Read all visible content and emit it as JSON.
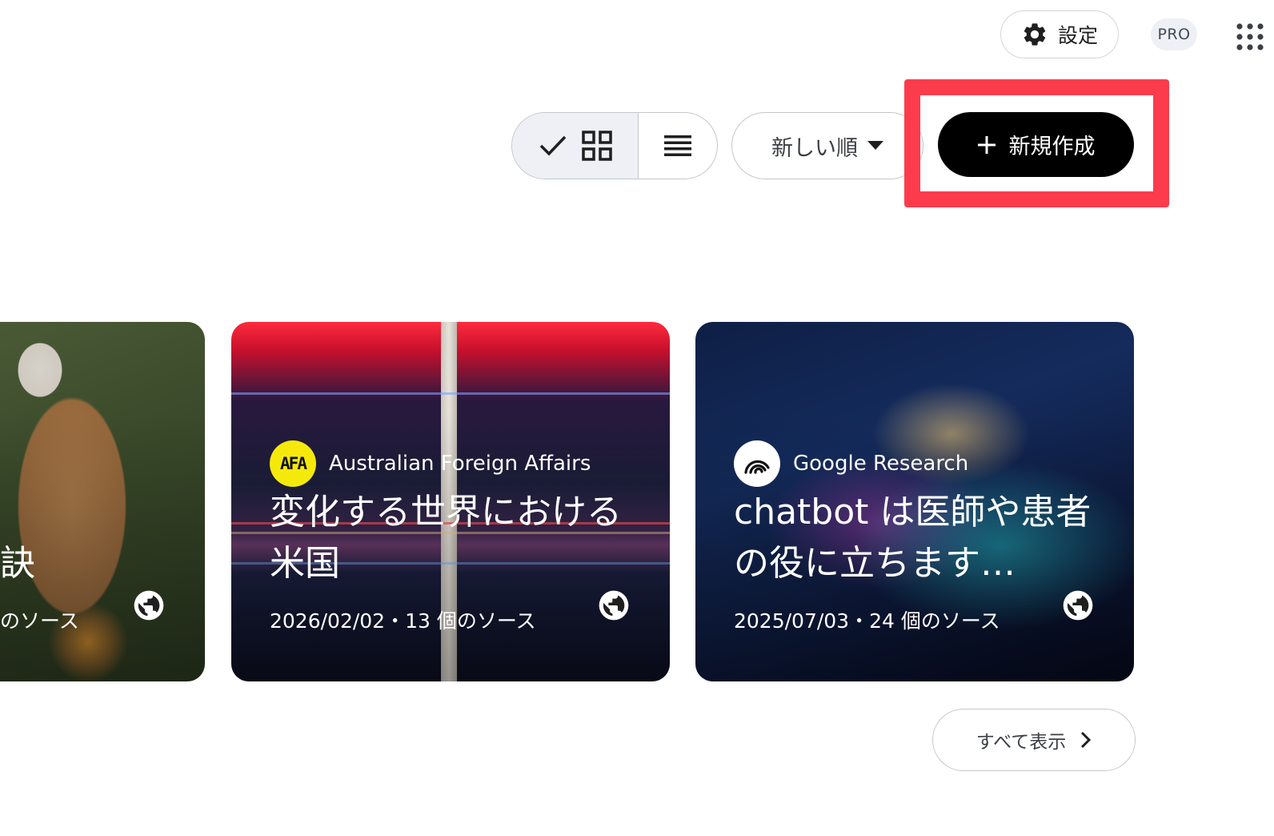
{
  "header": {
    "settings_label": "設定",
    "settings_icon": "gear-icon",
    "plan_badge": "PRO",
    "apps_icon": "apps-grid-icon"
  },
  "toolbar": {
    "view_mode": "grid",
    "grid_view_icon": "grid-icon",
    "list_view_icon": "list-icon",
    "sort_label": "新しい順",
    "new_label": "新規作成",
    "highlight_color": "#fc3b4d"
  },
  "notebooks": [
    {
      "title": "訣",
      "meta": "のソース",
      "visibility_icon": "globe-icon"
    },
    {
      "source_name": "Australian Foreign Affairs",
      "source_logo_text": "AFA",
      "title": "変化する世界における米国",
      "meta": "2026/02/02・13 個のソース",
      "visibility_icon": "globe-icon"
    },
    {
      "source_name": "Google Research",
      "title": "chatbot は医師や患者の役に立ちます…",
      "meta": "2025/07/03・24 個のソース",
      "visibility_icon": "globe-icon"
    }
  ],
  "view_all_label": "すべて表示",
  "colors": {
    "primary_button": "#000000",
    "selected_toggle": "#eef0f6",
    "border": "#c4c7cc"
  }
}
